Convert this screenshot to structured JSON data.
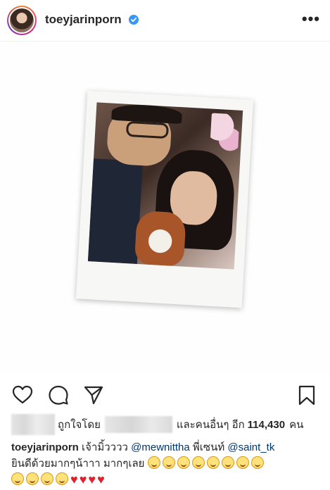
{
  "header": {
    "username": "toeyjarinporn",
    "more_glyph": "•••"
  },
  "actions": {
    "like_icon": "heart-icon",
    "comment_icon": "comment-icon",
    "share_icon": "share-icon",
    "save_icon": "bookmark-icon"
  },
  "likes": {
    "liked_by_label": "ถูกใจโดย",
    "others_label": "และคนอื่นๆ อีก",
    "count": "114,430",
    "unit": "คน"
  },
  "caption": {
    "username": "toeyjarinporn",
    "text_1": "เจ้ามิ้วววว",
    "mention_1": "@mewnittha",
    "text_2": "พี่เซนท์",
    "mention_2": "@saint_tk",
    "text_3": "ยินดีด้วยมากๆน้าาา มากๆเลย",
    "smile_emoji_count": 12,
    "heart_emoji_count": 4
  },
  "colors": {
    "text": "#262626",
    "mention": "#00376b",
    "verified": "#3897f0",
    "heart": "#e0202f"
  }
}
